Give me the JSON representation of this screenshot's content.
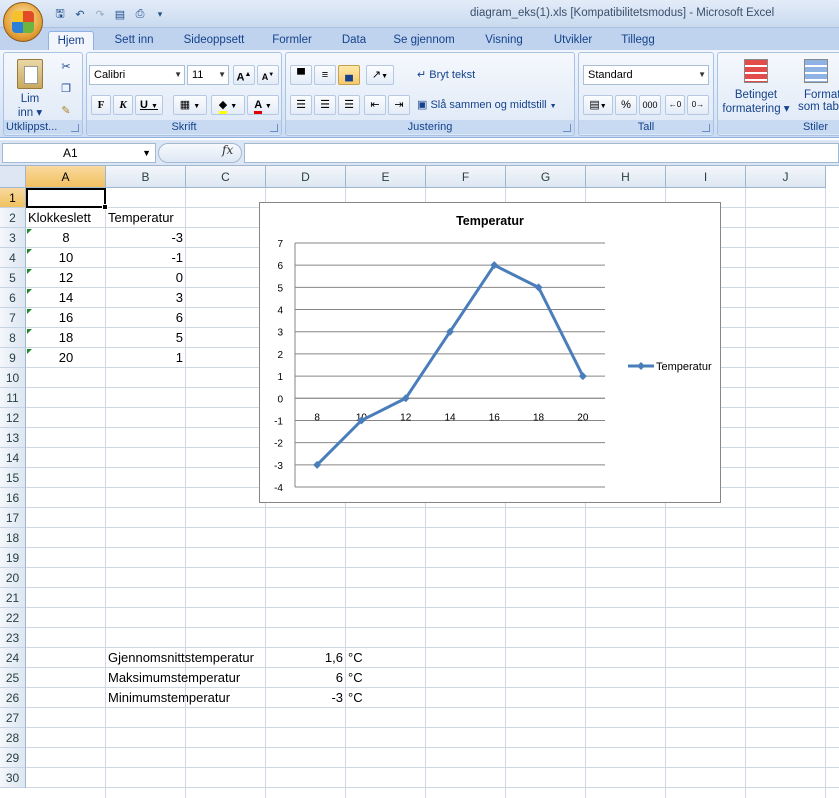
{
  "window": {
    "title": "diagram_eks(1).xls  [Kompatibilitetsmodus]  -  Microsoft Excel"
  },
  "ribbon": {
    "tabs": [
      "Hjem",
      "Sett inn",
      "Sideoppsett",
      "Formler",
      "Data",
      "Se gjennom",
      "Visning",
      "Utvikler",
      "Tillegg"
    ],
    "active_tab": "Hjem",
    "clipboard": {
      "paste_label": "Lim",
      "paste_label2": "inn",
      "group_label": "Utklippst..."
    },
    "font": {
      "name": "Calibri",
      "size": "11",
      "bold": "F",
      "italic": "K",
      "underline": "U",
      "group_label": "Skrift"
    },
    "alignment": {
      "wrap_text": "Bryt tekst",
      "merge_center": "Slå sammen og midtstill",
      "group_label": "Justering"
    },
    "number": {
      "format": "Standard",
      "percent": "%",
      "thousands": "000",
      "group_label": "Tall"
    },
    "styles": {
      "conditional1": "Betinget",
      "conditional2": "formatering",
      "format_table1": "Format",
      "format_table2": "som tab",
      "group_label": "Stiler"
    }
  },
  "formula_bar": {
    "name_box": "A1",
    "fx": "fx",
    "formula": ""
  },
  "columns": [
    "A",
    "B",
    "C",
    "D",
    "E",
    "F",
    "G",
    "H",
    "I",
    "J"
  ],
  "rows": [
    "1",
    "2",
    "3",
    "4",
    "5",
    "6",
    "7",
    "8",
    "9",
    "10",
    "11",
    "12",
    "13",
    "14",
    "15",
    "16",
    "17",
    "18",
    "19",
    "20",
    "21",
    "22",
    "23",
    "24",
    "25",
    "26",
    "27",
    "28",
    "29",
    "30"
  ],
  "sheet": {
    "header_a": "Klokkeslett",
    "header_b": "Temperatur",
    "data": [
      {
        "time": "8",
        "temp": "-3"
      },
      {
        "time": "10",
        "temp": "-1"
      },
      {
        "time": "12",
        "temp": "0"
      },
      {
        "time": "14",
        "temp": "3"
      },
      {
        "time": "16",
        "temp": "6"
      },
      {
        "time": "18",
        "temp": "5"
      },
      {
        "time": "20",
        "temp": "1"
      }
    ],
    "summary": [
      {
        "label": "Gjennomsnittstemperatur",
        "value": "1,6",
        "unit": "°C"
      },
      {
        "label": "Maksimumstemperatur",
        "value": "6",
        "unit": "°C"
      },
      {
        "label": "Minimumstemperatur",
        "value": "-3",
        "unit": "°C"
      }
    ]
  },
  "chart_data": {
    "type": "line",
    "title": "Temperatur",
    "categories": [
      "8",
      "10",
      "12",
      "14",
      "16",
      "18",
      "20"
    ],
    "series": [
      {
        "name": "Temperatur",
        "values": [
          -3,
          -1,
          0,
          3,
          6,
          5,
          1
        ],
        "color": "#4a7ebb"
      }
    ],
    "ylim": [
      -4,
      7
    ],
    "yticks": [
      7,
      6,
      5,
      4,
      3,
      2,
      1,
      0,
      -1,
      -2,
      -3,
      -4
    ],
    "grid": true,
    "legend": "right"
  }
}
